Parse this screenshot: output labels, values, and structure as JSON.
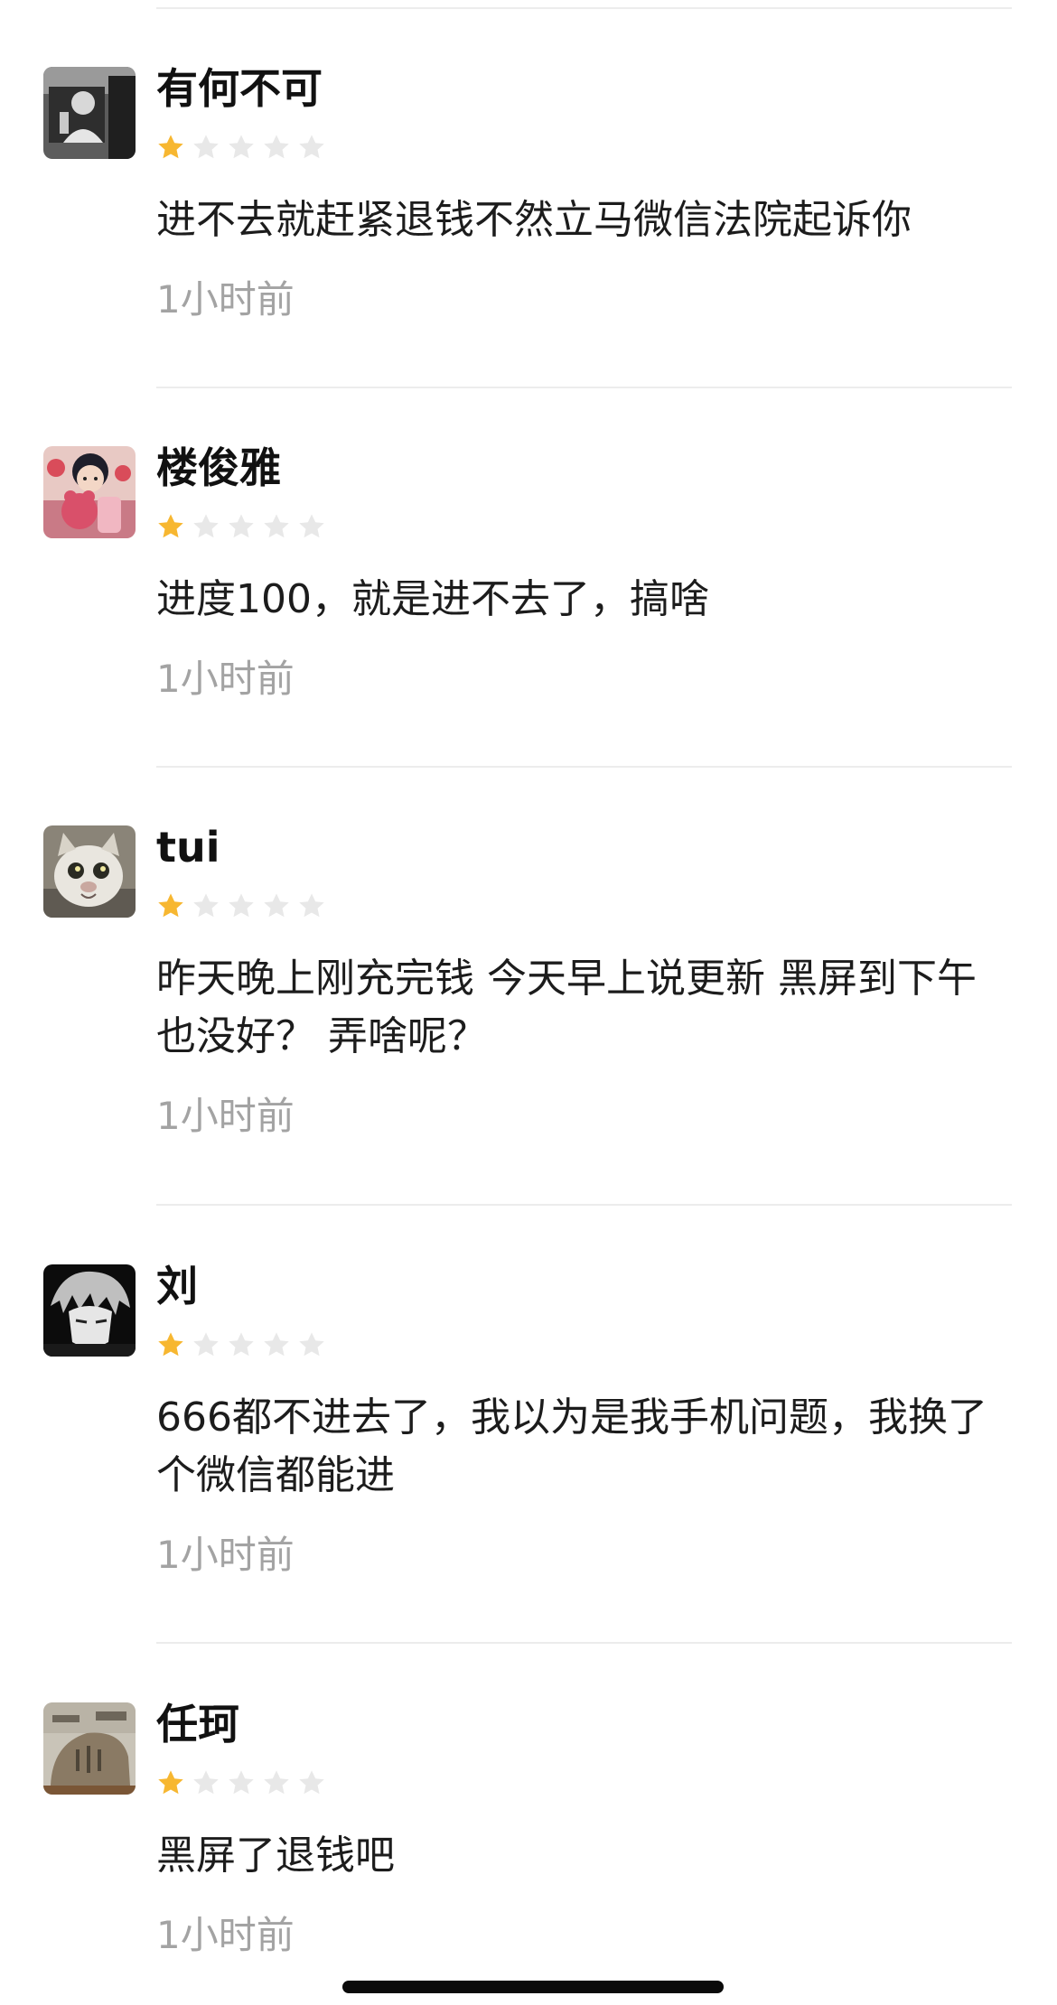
{
  "reviews": [
    {
      "author": "有何不可",
      "rating": 1,
      "max_rating": 5,
      "content": "进不去就赶紧退钱不然立马微信法院起诉你",
      "time": "1小时前",
      "avatar": "person-in-car-photo"
    },
    {
      "author": "楼俊雅",
      "rating": 1,
      "max_rating": 5,
      "content": "进度100，就是进不去了，搞啥",
      "time": "1小时前",
      "avatar": "cartoon-boy-with-bear"
    },
    {
      "author": "tui",
      "rating": 1,
      "max_rating": 5,
      "content": "昨天晚上刚充完钱 今天早上说更新 黑屏到下午也没好？ 弄啥呢？",
      "time": "1小时前",
      "avatar": "cat-photo"
    },
    {
      "author": "刘",
      "rating": 1,
      "max_rating": 5,
      "content": "666都不进去了，我以为是我手机问题，我换了个微信都能进",
      "time": "1小时前",
      "avatar": "anime-boy-monochrome"
    },
    {
      "author": "任珂",
      "rating": 1,
      "max_rating": 5,
      "content": "黑屏了退钱吧",
      "time": "1小时前",
      "avatar": "stone-monument-photo"
    }
  ],
  "colors": {
    "star_filled": "#F7B731",
    "star_empty": "#E8E8E8",
    "time_text": "#A3A3A3",
    "divider": "#ECECEC"
  },
  "icons": {
    "star": "star-icon",
    "home_indicator": "home-indicator-bar"
  }
}
